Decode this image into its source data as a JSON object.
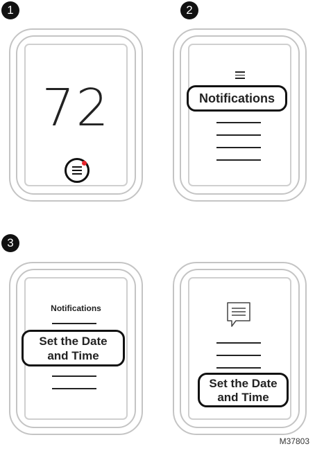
{
  "steps": {
    "one": "1",
    "two": "2",
    "three": "3"
  },
  "panels": {
    "panel1": {
      "temperature": "72",
      "icon": "menu-icon",
      "alert_color": "#e8262d"
    },
    "panel2": {
      "icon": "menu-icon",
      "highlight_label": "Notifications"
    },
    "panel3": {
      "heading": "Notifications",
      "highlight_line1": "Set the Date",
      "highlight_line2": "and Time"
    },
    "panel4": {
      "icon": "message-icon",
      "highlight_line1": "Set the Date",
      "highlight_line2": "and Time"
    }
  },
  "figure_code": "M37803"
}
